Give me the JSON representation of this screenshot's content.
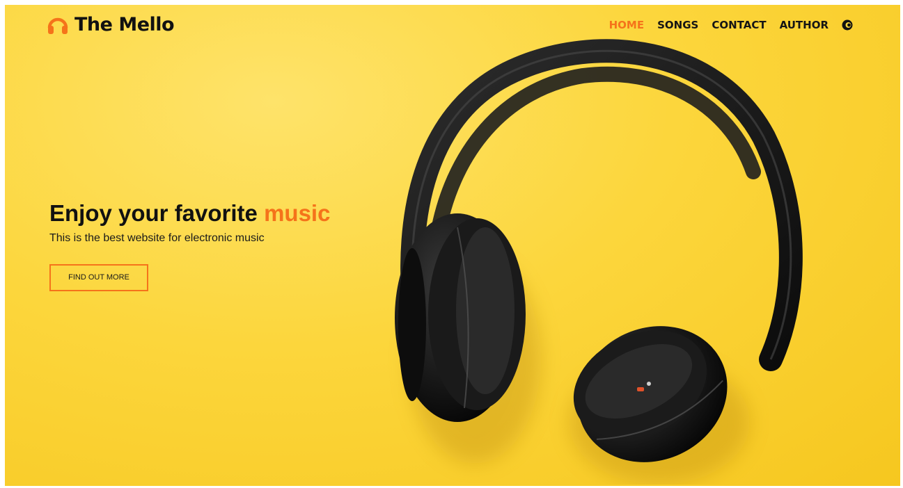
{
  "brand": {
    "name": "The Mello",
    "icon": "headphones-icon",
    "accent_color": "#f5731a"
  },
  "nav": {
    "items": [
      {
        "label": "HOME",
        "active": true
      },
      {
        "label": "SONGS",
        "active": false
      },
      {
        "label": "CONTACT",
        "active": false
      },
      {
        "label": "AUTHOR",
        "active": false
      }
    ],
    "language_icon": "language-flag-icon"
  },
  "hero": {
    "title_main": "Enjoy your favorite ",
    "title_accent": "music",
    "subtitle": "This is the best website for electronic music",
    "cta_label": "FIND OUT MORE"
  },
  "background": {
    "color": "#fcd63c",
    "image": "black-headphones-on-yellow"
  }
}
